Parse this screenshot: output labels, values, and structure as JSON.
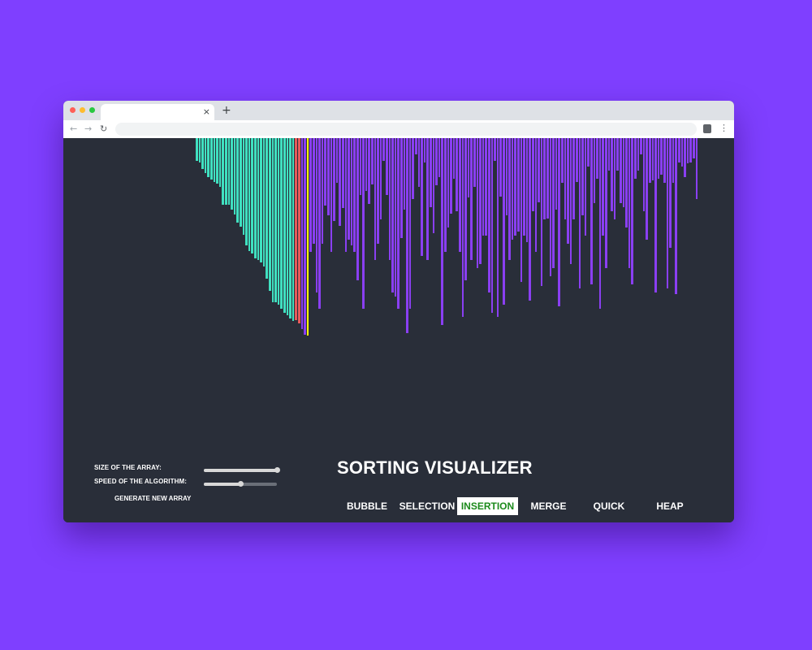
{
  "browser": {
    "tab_close": "×",
    "new_tab": "+",
    "back": "←",
    "forward": "→",
    "reload": "↻",
    "menu": "⋮",
    "address": ""
  },
  "app": {
    "title": "SORTING VISUALIZER",
    "size_label": "SIZE OF THE ARRAY:",
    "speed_label": "SPEED OF THE ALGORITHM:",
    "size_value": 1.0,
    "speed_value": 0.5,
    "generate_label": "GENERATE NEW ARRAY",
    "algorithms": [
      {
        "label": "BUBBLE",
        "active": false
      },
      {
        "label": "SELECTION",
        "active": false
      },
      {
        "label": "INSERTION",
        "active": true
      },
      {
        "label": "MERGE",
        "active": false
      },
      {
        "label": "QUICK",
        "active": false
      },
      {
        "label": "HEAP",
        "active": false
      }
    ]
  },
  "colors": {
    "page_background": "#7f3fff",
    "app_background": "#292e39",
    "sorted": "#40e0c0",
    "unsorted": "#8a3ff2",
    "comparing": "#e65a5a",
    "current": "#ffff00",
    "active_button_text": "#1c8a1c"
  },
  "array": {
    "sorted": [
      28,
      30,
      38,
      43,
      48,
      51,
      54,
      56,
      60,
      82,
      82,
      82,
      88,
      94,
      104,
      109,
      119,
      132,
      139,
      142,
      148,
      150,
      153,
      158,
      173,
      188,
      202,
      202,
      205,
      210,
      215,
      218,
      222,
      225
    ],
    "comparing": [
      224,
      228
    ],
    "pivot": [
      235,
      242
    ],
    "current": 243,
    "unsorted": [
      140,
      130,
      190,
      210,
      130,
      83,
      95,
      140,
      102,
      55,
      108,
      86,
      140,
      125,
      132,
      140,
      175,
      70,
      210,
      65,
      81,
      57,
      150,
      130,
      100,
      28,
      70,
      150,
      190,
      195,
      210,
      123,
      88,
      240,
      210,
      75,
      20,
      60,
      145,
      30,
      150,
      85,
      117,
      58,
      48,
      230,
      140,
      110,
      93,
      50,
      90,
      140,
      220,
      175,
      73,
      150,
      60,
      160,
      155,
      120,
      120,
      190,
      215,
      28,
      220,
      72,
      205,
      95,
      150,
      125,
      120,
      115,
      177,
      120,
      128,
      200,
      90,
      140,
      79,
      182,
      100,
      99,
      170,
      160,
      88,
      207,
      55,
      100,
      130,
      155,
      100,
      54,
      185,
      95,
      120,
      35,
      180,
      80,
      50,
      210,
      120,
      160,
      40,
      90,
      100,
      40,
      80,
      85,
      110,
      160,
      180,
      50,
      40,
      20,
      90,
      125,
      55,
      52,
      190,
      50,
      45,
      55,
      185,
      135,
      55,
      192,
      30,
      35,
      48,
      31,
      30,
      25,
      75
    ]
  }
}
